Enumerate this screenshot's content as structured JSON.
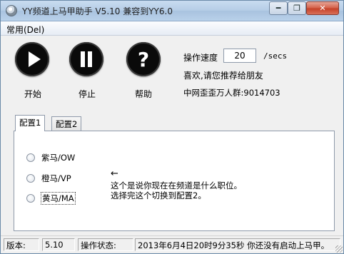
{
  "window": {
    "title": "YY频道上马甲助手 V5.10 兼容到YY6.0",
    "minimize_label": "━",
    "maximize_label": "❐",
    "close_label": "✕"
  },
  "menu": {
    "items": [
      "常用(Del)"
    ]
  },
  "toolbar": {
    "start_label": "开始",
    "stop_label": "停止",
    "help_label": "帮助"
  },
  "settings": {
    "speed_label": "操作速度",
    "speed_value": "20",
    "speed_unit": "/secs",
    "recommend_text": "喜欢,请您推荐给朋友",
    "group_text": "中网歪歪万人群:9014703"
  },
  "tabs": [
    {
      "label": "配置1",
      "selected": true
    },
    {
      "label": "配置2",
      "selected": false
    }
  ],
  "roles": [
    {
      "label": "紫马/OW",
      "checked": false
    },
    {
      "label": "橙马/VP",
      "checked": false
    },
    {
      "label": "黄马/MA",
      "checked": false
    }
  ],
  "note": {
    "arrow": "←",
    "line1": "这个是说你现在在频道是什么职位。",
    "line2": "选择完这个切换到配置2。"
  },
  "statusbar": {
    "version_label": "版本:",
    "version_value": "5.10",
    "state_label": "操作状态:",
    "status_text": "2013年6月4日20时9分35秒  你还没有启动上马甲。"
  },
  "colors": {
    "titlebar": "#b6cde6",
    "close_button": "#c6432a",
    "window_bg": "#f0f0f0"
  }
}
